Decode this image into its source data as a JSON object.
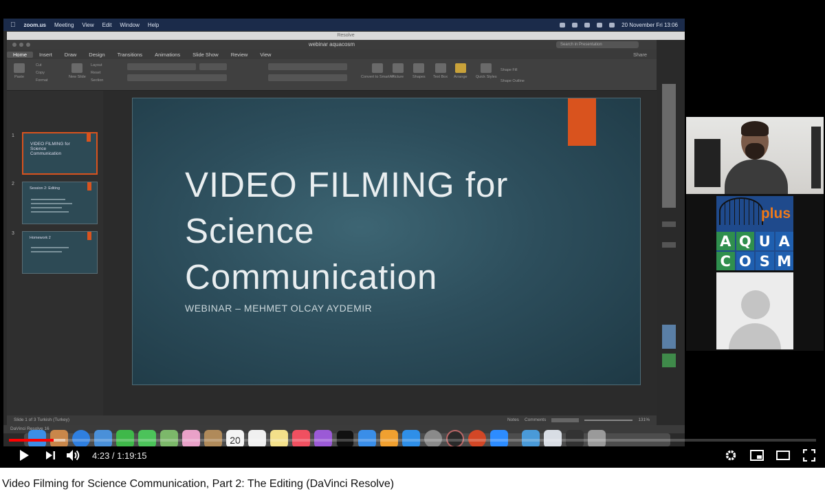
{
  "mac_menubar": {
    "items": [
      "zoom.us",
      "Meeting",
      "View",
      "Edit",
      "Window",
      "Help"
    ],
    "clock": "20 November Fri  13:06"
  },
  "app_window_title": "Resolve",
  "powerpoint": {
    "doc_title": "webinar aquacosm",
    "search_placeholder": "Search in Presentation",
    "share_label": "Share",
    "ribbon_tabs": [
      "Home",
      "Insert",
      "Draw",
      "Design",
      "Transitions",
      "Animations",
      "Slide Show",
      "Review",
      "View"
    ],
    "active_tab": "Home",
    "ribbon_groups": [
      "Paste",
      "Cut",
      "Copy",
      "Format",
      "New Slide",
      "Layout",
      "Reset",
      "Section",
      "Convert to SmartArt",
      "Picture",
      "Shapes",
      "Text Box",
      "Arrange",
      "Quick Styles",
      "Shape Fill",
      "Shape Outline"
    ],
    "thumbnails": [
      {
        "num": "1",
        "text": "VIDEO FILMING for Science Communication",
        "selected": true
      },
      {
        "num": "2",
        "text": "Session 2: Editing",
        "selected": false
      },
      {
        "num": "3",
        "text": "Homework 2",
        "selected": false
      }
    ],
    "slide": {
      "title_line1": "VIDEO FILMING for",
      "title_line2": "Science",
      "title_line3": "Communication",
      "subtitle": "WEBINAR – MEHMET OLCAY AYDEMIR",
      "accent_color": "#d9531e"
    },
    "status_left": "Slide 1 of 3    Turkish (Turkey)",
    "status_notes": "Notes",
    "status_comments": "Comments",
    "zoom_level": "131%"
  },
  "resolve_bar": "DaVinci Resolve 16",
  "dock_calendar_day": "20",
  "dock_apps": [
    "finder-icon",
    "launchpad-icon",
    "safari-icon",
    "mail-icon",
    "facetime-icon",
    "messages-icon",
    "maps-icon",
    "photos-icon",
    "contacts-icon",
    "calendar-icon",
    "reminders-icon",
    "notes-icon",
    "music-icon",
    "podcasts-icon",
    "tv-icon",
    "keynote-icon",
    "pages-icon",
    "app-store-icon",
    "system-prefs-icon",
    "davinci-icon",
    "powerpoint-icon",
    "zoom-icon",
    "folder-icon",
    "preview-icon",
    "trash-icon"
  ],
  "logo": {
    "plus": "plus",
    "letters_row1": [
      "A",
      "Q",
      "U",
      "A"
    ],
    "letters_row2": [
      "C",
      "O",
      "S",
      "M"
    ],
    "row1_bg": [
      "#2f8f4e",
      "#2f8f4e",
      "#1f5faf",
      "#1f5faf"
    ],
    "row2_bg": [
      "#2f8f4e",
      "#1f5faf",
      "#1f5faf",
      "#1f5faf"
    ]
  },
  "player": {
    "time": "4:23 / 1:19:15",
    "progress_fraction": 0.0554,
    "buffered_fraction": 0.07
  },
  "video_title": "Video Filming for Science Communication, Part 2: The Editing (DaVinci Resolve)"
}
